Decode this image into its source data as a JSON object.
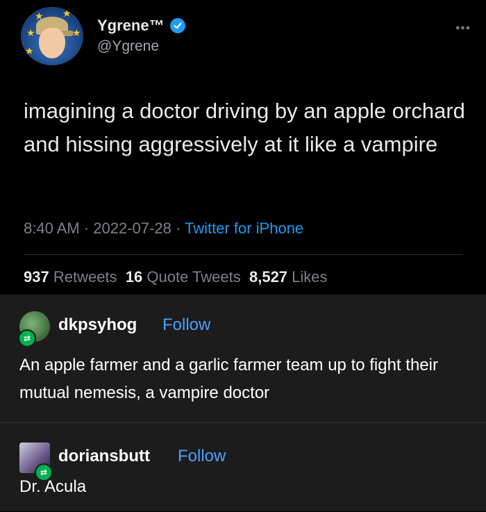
{
  "tweet": {
    "display_name": "Ygrene™",
    "handle": "@Ygrene",
    "more_label": "•••",
    "text": "imagining a doctor driving by an apple orchard and hissing aggressively at it like a vampire",
    "time": "8:40 AM",
    "date": "2022-07-28",
    "separator": " · ",
    "source": "Twitter for iPhone",
    "stats": {
      "retweets_count": "937",
      "retweets_label": "Retweets",
      "quotes_count": "16",
      "quotes_label": "Quote Tweets",
      "likes_count": "8,527",
      "likes_label": "Likes"
    },
    "icons": {
      "verified": "verified-badge-icon",
      "more": "more-options-icon"
    },
    "colors": {
      "accent": "#1d9bf0",
      "background": "#000000"
    }
  },
  "tumblr": {
    "posts": [
      {
        "username": "dkpsyhog",
        "follow_label": "Follow",
        "text": "An apple farmer and a garlic farmer team up to fight their mutual nemesis, a vampire doctor",
        "reblog_icon": "reblog-icon"
      },
      {
        "username": "doriansbutt",
        "follow_label": "Follow",
        "text": "Dr. Acula",
        "reblog_icon": "reblog-icon"
      }
    ],
    "colors": {
      "background": "#1c1c1c",
      "follow": "#4aa0ff",
      "reblog": "#00b14f"
    }
  }
}
